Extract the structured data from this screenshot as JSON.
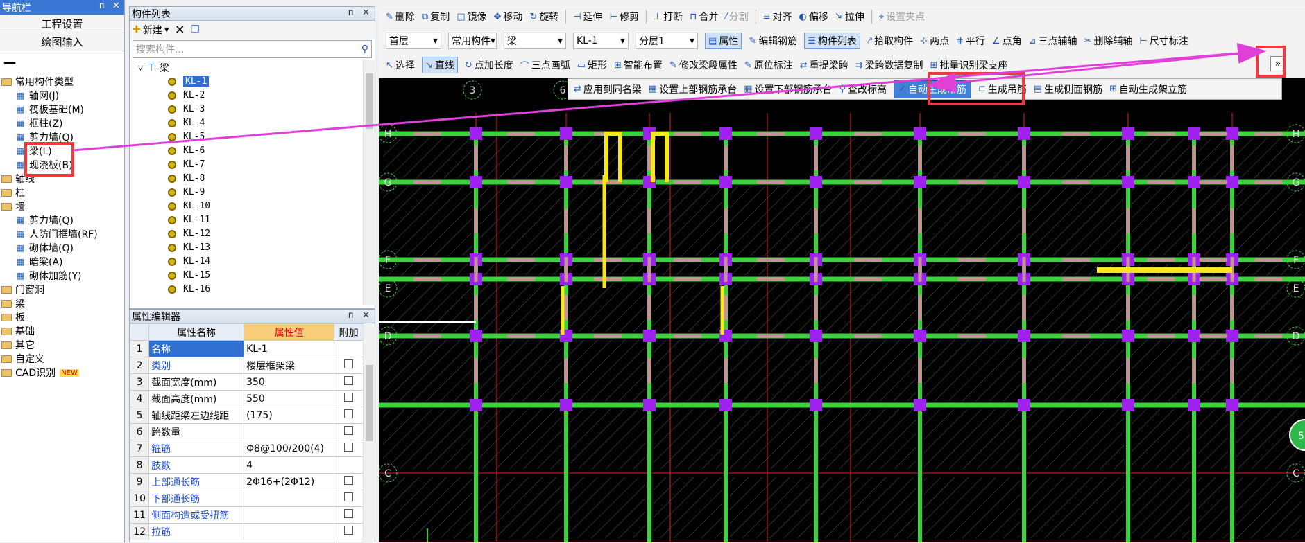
{
  "nav": {
    "title": "导航栏",
    "pin": "ᴨ",
    "close": "✕",
    "btn1": "工程设置",
    "btn2": "绘图输入",
    "dash": "━╸",
    "tree": [
      {
        "label": "常用构件类型",
        "type": "folder",
        "level": 0
      },
      {
        "label": "轴网(J)",
        "type": "item",
        "level": 1
      },
      {
        "label": "筏板基础(M)",
        "type": "item",
        "level": 1
      },
      {
        "label": "框柱(Z)",
        "type": "item",
        "level": 1
      },
      {
        "label": "剪力墙(Q)",
        "type": "item",
        "level": 1
      },
      {
        "label": "梁(L)",
        "type": "item",
        "level": 1
      },
      {
        "label": "现浇板(B)",
        "type": "item",
        "level": 1
      },
      {
        "label": "轴线",
        "type": "folder",
        "level": 0
      },
      {
        "label": "柱",
        "type": "folder",
        "level": 0
      },
      {
        "label": "墙",
        "type": "folder",
        "level": 0
      },
      {
        "label": "剪力墙(Q)",
        "type": "item",
        "level": 1
      },
      {
        "label": "人防门框墙(RF)",
        "type": "item",
        "level": 1
      },
      {
        "label": "砌体墙(Q)",
        "type": "item",
        "level": 1
      },
      {
        "label": "暗梁(A)",
        "type": "item",
        "level": 1
      },
      {
        "label": "砌体加筋(Y)",
        "type": "item",
        "level": 1
      },
      {
        "label": "门窗洞",
        "type": "folder",
        "level": 0
      },
      {
        "label": "梁",
        "type": "folder",
        "level": 0
      },
      {
        "label": "板",
        "type": "folder",
        "level": 0
      },
      {
        "label": "基础",
        "type": "folder",
        "level": 0
      },
      {
        "label": "其它",
        "type": "folder",
        "level": 0
      },
      {
        "label": "自定义",
        "type": "folder",
        "level": 0
      },
      {
        "label": "CAD识别",
        "type": "folder",
        "level": 0,
        "badge": "NEW"
      }
    ]
  },
  "components": {
    "title": "构件列表",
    "new": "新建",
    "search_placeholder": "搜索构件...",
    "root": "梁",
    "items": [
      "KL-1",
      "KL-2",
      "KL-3",
      "KL-4",
      "KL-5",
      "KL-6",
      "KL-7",
      "KL-8",
      "KL-9",
      "KL-10",
      "KL-11",
      "KL-12",
      "KL-13",
      "KL-14",
      "KL-15",
      "KL-16"
    ]
  },
  "props": {
    "title": "属性编辑器",
    "col_name": "属性名称",
    "col_value": "属性值",
    "col_extra": "附加",
    "rows": [
      {
        "n": "1",
        "name": "名称",
        "value": "KL-1",
        "blue": true,
        "cb": false
      },
      {
        "n": "2",
        "name": "类别",
        "value": "楼层框架梁",
        "blue": true,
        "cb": true
      },
      {
        "n": "3",
        "name": "截面宽度(mm)",
        "value": "350",
        "blue": false,
        "cb": true
      },
      {
        "n": "4",
        "name": "截面高度(mm)",
        "value": "550",
        "blue": false,
        "cb": true
      },
      {
        "n": "5",
        "name": "轴线距梁左边线距",
        "value": "(175)",
        "blue": false,
        "cb": true
      },
      {
        "n": "6",
        "name": "跨数量",
        "value": "",
        "blue": false,
        "cb": true
      },
      {
        "n": "7",
        "name": "箍筋",
        "value": "Φ8@100/200(4)",
        "blue": true,
        "cb": true
      },
      {
        "n": "8",
        "name": "肢数",
        "value": "4",
        "blue": true,
        "cb": false
      },
      {
        "n": "9",
        "name": "上部通长筋",
        "value": "2Φ16+(2Φ12)",
        "blue": true,
        "cb": true
      },
      {
        "n": "10",
        "name": "下部通长筋",
        "value": "",
        "blue": true,
        "cb": true
      },
      {
        "n": "11",
        "name": "侧面构造或受扭筋",
        "value": "",
        "blue": true,
        "cb": true
      },
      {
        "n": "12",
        "name": "拉筋",
        "value": "",
        "blue": true,
        "cb": true
      }
    ]
  },
  "toolbar": {
    "row1": [
      "删除",
      "复制",
      "镜像",
      "移动",
      "旋转",
      "延伸",
      "修剪",
      "打断",
      "合并",
      "分割",
      "对齐",
      "偏移",
      "拉伸",
      "设置夹点"
    ],
    "row2_dd": [
      "首层",
      "常用构件",
      "梁",
      "KL-1",
      "分层1"
    ],
    "row2": [
      "属性",
      "编辑钢筋",
      "构件列表",
      "拾取构件",
      "两点",
      "平行",
      "点角",
      "三点辅轴",
      "删除辅轴",
      "尺寸标注"
    ],
    "row3": [
      "选择",
      "直线",
      "点加长度",
      "三点画弧",
      "矩形",
      "智能布置",
      "修改梁段属性",
      "原位标注",
      "重提梁跨",
      "梁跨数据复制",
      "批量识别梁支座"
    ],
    "more": "»"
  },
  "popup": {
    "items": [
      "应用到同名梁",
      "设置上部钢筋承台",
      "设置下部钢筋承台",
      "查改标高",
      "自动生成吊筋",
      "生成吊筋",
      "生成侧面钢筋",
      "自动生成架立筋"
    ]
  },
  "cad": {
    "axis_top": [
      "3",
      "6"
    ],
    "axis_left": [
      "H",
      "G",
      "F",
      "E",
      "D",
      "C"
    ],
    "axis_right": [
      "H",
      "G",
      "F",
      "E",
      "D",
      "C"
    ],
    "bubble": "5"
  },
  "colors": {
    "wall": "#3cd23c",
    "beam_pink": "#c8909a",
    "purple": "#a020f0",
    "yellow": "#f7e61a",
    "grid": "#e02020",
    "hatch": "#5a5a5a",
    "highlight": "#f2383f",
    "arrow": "#e040d8"
  }
}
